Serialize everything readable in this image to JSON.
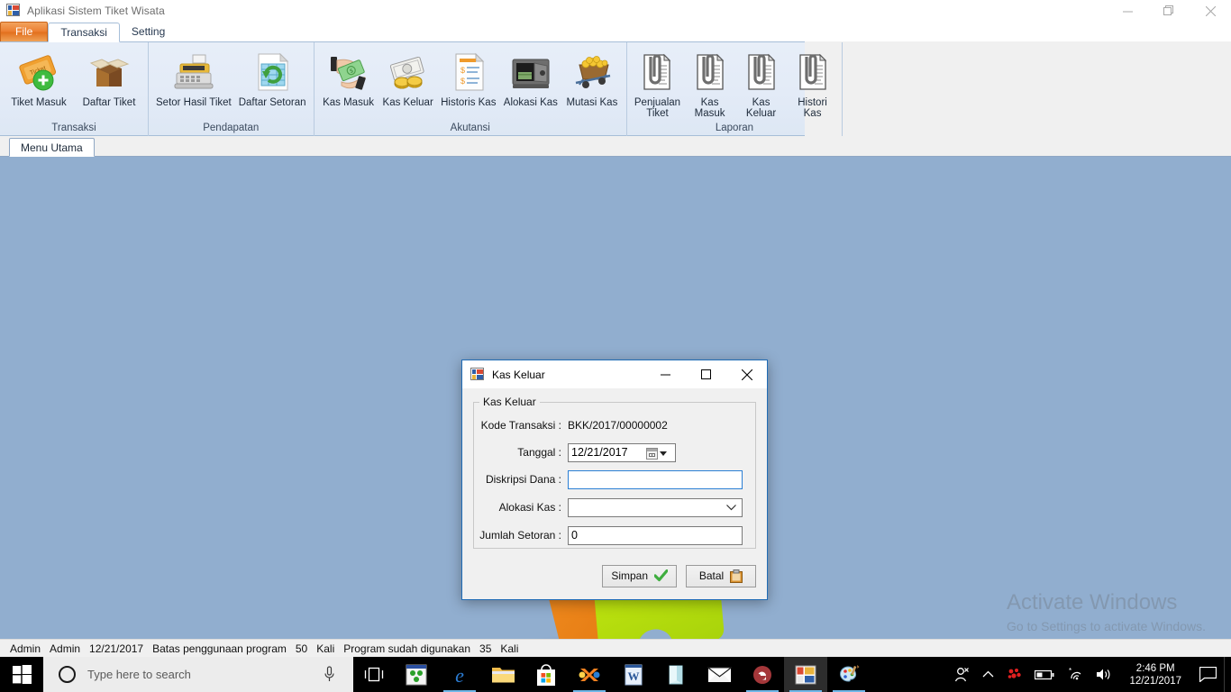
{
  "window": {
    "title": "Aplikasi Sistem Tiket Wisata",
    "icon": "vs-form-icon",
    "minimize": "minimize-icon",
    "maximize": "restore-icon",
    "close": "close-icon"
  },
  "ribbon": {
    "tabs": [
      {
        "label": "File",
        "name": "tab-file"
      },
      {
        "label": "Transaksi",
        "name": "tab-transaksi"
      },
      {
        "label": "Setting",
        "name": "tab-setting"
      }
    ],
    "groups": [
      {
        "label": "Transaksi",
        "buttons": [
          {
            "label": "Tiket Masuk",
            "icon": "ticket-add-icon"
          },
          {
            "label": "Daftar Tiket",
            "icon": "open-box-icon"
          }
        ]
      },
      {
        "label": "Pendapatan",
        "buttons": [
          {
            "label": "Setor Hasil Tiket",
            "icon": "cash-register-icon"
          },
          {
            "label": "Daftar Setoran",
            "icon": "refresh-sheet-icon"
          }
        ]
      },
      {
        "label": "Akutansi",
        "buttons": [
          {
            "label": "Kas Masuk",
            "icon": "hand-money-icon"
          },
          {
            "label": "Kas Keluar",
            "icon": "money-coins-icon"
          },
          {
            "label": "Historis Kas",
            "icon": "document-list-icon"
          },
          {
            "label": "Alokasi Kas",
            "icon": "safe-box-icon"
          },
          {
            "label": "Mutasi Kas",
            "icon": "gold-cart-icon"
          }
        ]
      },
      {
        "label": "Laporan",
        "buttons": [
          {
            "label": "Penjualan\nTiket",
            "icon": "report-clip-icon"
          },
          {
            "label": "Kas\nMasuk",
            "icon": "report-clip-icon"
          },
          {
            "label": "Kas\nKeluar",
            "icon": "report-clip-icon"
          },
          {
            "label": "Histori\nKas",
            "icon": "report-clip-icon"
          }
        ]
      }
    ]
  },
  "mdi": {
    "tab_label": "Menu Utama"
  },
  "watermark": {
    "title": "Activate Windows",
    "subtitle": "Go to Settings to activate Windows."
  },
  "dialog": {
    "title": "Kas Keluar",
    "icon": "vs-form-icon",
    "minimize": "minimize-icon",
    "maximize": "maximize-icon",
    "close": "close-icon",
    "group_legend": "Kas Keluar",
    "fields": [
      {
        "label": "Kode Transaksi :",
        "value": "BKK/2017/00000002",
        "type": "static"
      },
      {
        "label": "Tanggal :",
        "value": "12/21/2017",
        "type": "datepicker"
      },
      {
        "label": "Diskripsi Dana :",
        "value": "",
        "placeholder": "",
        "type": "textbox",
        "focused": true
      },
      {
        "label": "Alokasi Kas :",
        "value": "",
        "type": "combobox"
      },
      {
        "label": "Jumlah Setoran :",
        "value": "0",
        "type": "textbox"
      }
    ],
    "buttons": [
      {
        "label": "Simpan",
        "icon": "green-check-icon",
        "name": "save-button"
      },
      {
        "label": "Batal",
        "icon": "clipboard-icon",
        "name": "cancel-button"
      }
    ]
  },
  "status_bar": {
    "user_role": "Admin",
    "user_name": "Admin",
    "date": "12/21/2017",
    "limit_label": "Batas penggunaan program",
    "limit_value": "50",
    "limit_unit": "Kali",
    "used_label": "Program sudah digunakan",
    "used_value": "35",
    "used_unit": "Kali"
  },
  "taskbar": {
    "start": "windows-logo-icon",
    "search_placeholder": "Type here to search",
    "cortana": "cortana-circle-icon",
    "mic": "microphone-icon",
    "task_view": "task-view-icon",
    "apps": [
      {
        "name": "visual-studio-icon",
        "running": false
      },
      {
        "name": "edge-icon",
        "running": true
      },
      {
        "name": "file-explorer-icon",
        "running": false
      },
      {
        "name": "microsoft-store-icon",
        "running": false
      },
      {
        "name": "xampp-icon",
        "running": true
      },
      {
        "name": "word-icon",
        "running": false
      },
      {
        "name": "onenote-icon",
        "running": false
      },
      {
        "name": "mail-icon",
        "running": false
      },
      {
        "name": "access-icon",
        "running": true
      },
      {
        "name": "app-window-icon",
        "running": true,
        "active": true
      },
      {
        "name": "paint-icon",
        "running": true
      }
    ],
    "tray": [
      {
        "name": "people-icon"
      },
      {
        "name": "show-hidden-icons-icon"
      },
      {
        "name": "bluetooth-red-icon"
      },
      {
        "name": "battery-icon"
      },
      {
        "name": "wifi-icon"
      },
      {
        "name": "volume-icon"
      }
    ],
    "clock_time": "2:46 PM",
    "clock_date": "12/21/2017",
    "action_center": "action-center-icon"
  },
  "colors": {
    "file_tab": "#e67321",
    "ribbon_bg": "#e3ebf7",
    "desktop": "#91aecf",
    "dialog_border": "#1f6bb5",
    "focus_blue": "#2a7fd4",
    "taskbar": "#000000",
    "running_underline": "#6fb7e8"
  }
}
